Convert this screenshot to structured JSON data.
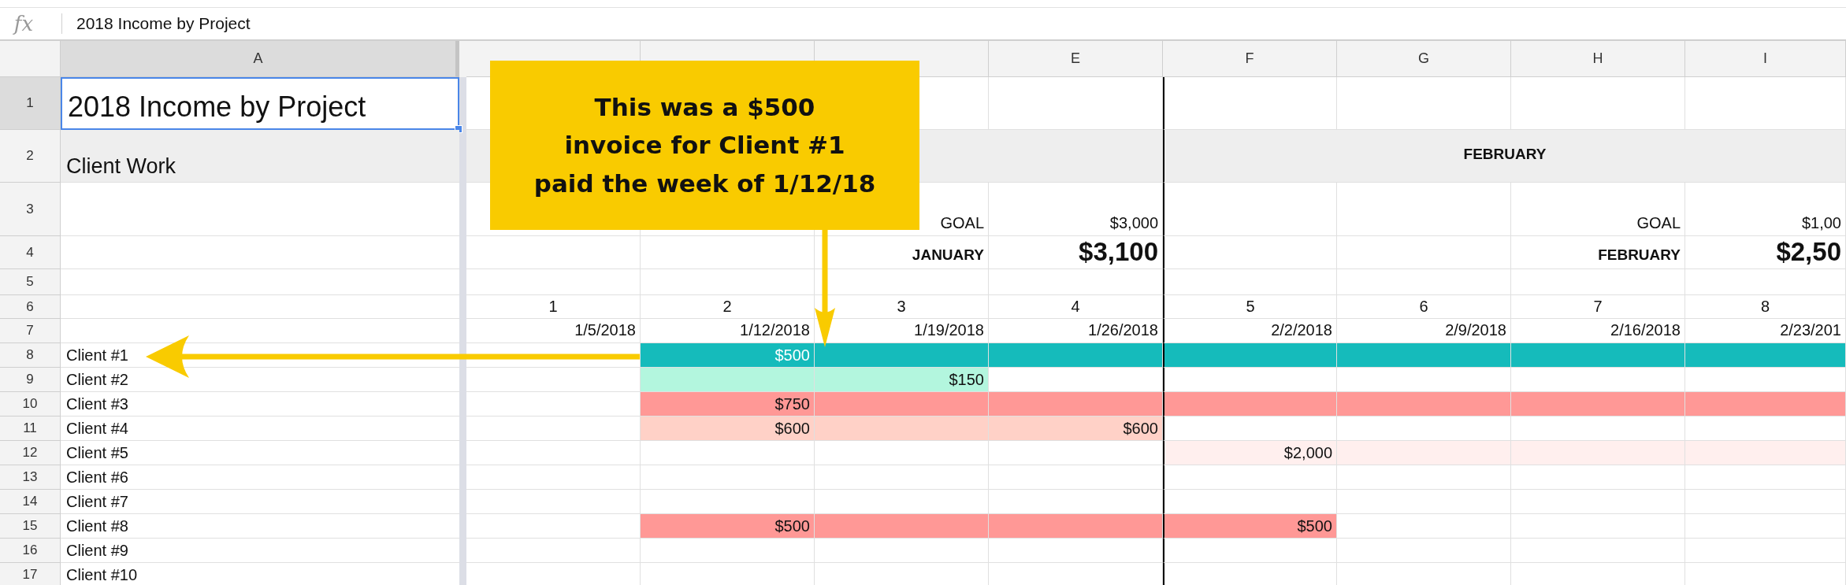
{
  "formula_bar": {
    "icon": "fx",
    "value": "2018 Income by Project"
  },
  "columns": [
    {
      "label": "A",
      "selected": true
    },
    {
      "selected": false
    },
    {
      "selected": false
    },
    {
      "selected": false
    },
    {
      "label": "E",
      "selected": false
    },
    {
      "label": "F",
      "selected": false,
      "divider": true
    },
    {
      "label": "G",
      "selected": false
    },
    {
      "label": "H",
      "selected": false
    },
    {
      "label": "I",
      "selected": false
    }
  ],
  "rows": [
    {
      "number": "1",
      "kind": "title",
      "selected": true,
      "a": {
        "text": "2018 Income by Project",
        "selected": true
      },
      "cells": [
        {},
        {},
        {},
        {},
        {},
        {},
        {},
        {}
      ]
    },
    {
      "number": "2",
      "kind": "month",
      "selected": false,
      "a": {
        "text": "Client Work",
        "selected": false
      },
      "cells": [
        {},
        {
          "text": "FEBRUARY"
        }
      ]
    },
    {
      "number": "3",
      "kind": "goal",
      "selected": false,
      "cells": [
        {},
        {},
        {
          "text": "GOAL"
        },
        {
          "text": "$3,000"
        },
        {},
        {},
        {
          "text": "GOAL"
        },
        {
          "text": "$1,00"
        }
      ]
    },
    {
      "number": "4",
      "kind": "total",
      "selected": false,
      "cells": [
        {},
        {},
        {
          "text": "JANUARY",
          "kind": "label"
        },
        {
          "text": "$3,100",
          "kind": "total"
        },
        {},
        {},
        {
          "text": "FEBRUARY",
          "kind": "label"
        },
        {
          "text": "$2,50",
          "kind": "total"
        }
      ]
    },
    {
      "number": "5",
      "kind": "blank",
      "selected": false,
      "cells": [
        {},
        {},
        {},
        {},
        {},
        {},
        {},
        {}
      ]
    },
    {
      "number": "6",
      "kind": "week",
      "selected": false,
      "cells": [
        {
          "text": "1"
        },
        {
          "text": "2"
        },
        {
          "text": "3"
        },
        {
          "text": "4"
        },
        {
          "text": "5"
        },
        {
          "text": "6"
        },
        {
          "text": "7"
        },
        {
          "text": "8"
        }
      ]
    },
    {
      "number": "7",
      "kind": "date",
      "selected": false,
      "cells": [
        {
          "text": "1/5/2018"
        },
        {
          "text": "1/12/2018"
        },
        {
          "text": "1/19/2018"
        },
        {
          "text": "1/26/2018"
        },
        {
          "text": "2/2/2018"
        },
        {
          "text": "2/9/2018"
        },
        {
          "text": "2/16/2018"
        },
        {
          "text": "2/23/201"
        }
      ]
    },
    {
      "number": "8",
      "kind": "client",
      "selected": false,
      "a": {
        "text": "Client #1",
        "selected": false
      },
      "cells": [
        {},
        {
          "text": "$500",
          "color": "#15bbbb"
        },
        {
          "color": "#15bbbb"
        },
        {
          "color": "#15bbbb"
        },
        {
          "color": "#15bbbb"
        },
        {
          "color": "#15bbbb"
        },
        {
          "color": "#15bbbb"
        },
        {
          "color": "#15bbbb"
        }
      ]
    },
    {
      "number": "9",
      "kind": "client",
      "selected": false,
      "a": {
        "text": "Client #2",
        "selected": false
      },
      "cells": [
        {},
        {
          "color": "#b3f6de"
        },
        {
          "text": "$150",
          "color": "#b3f6de"
        },
        {},
        {},
        {},
        {},
        {}
      ]
    },
    {
      "number": "10",
      "kind": "client",
      "selected": false,
      "a": {
        "text": "Client #3",
        "selected": false
      },
      "cells": [
        {},
        {
          "text": "$750",
          "color": "#ff9896"
        },
        {
          "color": "#ff9896"
        },
        {
          "color": "#ff9896"
        },
        {
          "color": "#ff9896"
        },
        {
          "color": "#ff9896"
        },
        {
          "color": "#ff9896"
        },
        {
          "color": "#ff9896"
        }
      ]
    },
    {
      "number": "11",
      "kind": "client",
      "selected": false,
      "a": {
        "text": "Client #4",
        "selected": false
      },
      "cells": [
        {},
        {
          "text": "$600",
          "color": "#ffd1c7"
        },
        {
          "color": "#ffd1c7"
        },
        {
          "text": "$600",
          "color": "#ffd1c7"
        },
        {},
        {},
        {},
        {}
      ]
    },
    {
      "number": "12",
      "kind": "client",
      "selected": false,
      "a": {
        "text": "Client #5",
        "selected": false
      },
      "cells": [
        {},
        {},
        {},
        {},
        {
          "text": "$2,000",
          "color": "#ffefee"
        },
        {
          "color": "#ffefee"
        },
        {
          "color": "#ffefee"
        },
        {
          "color": "#ffefee"
        }
      ]
    },
    {
      "number": "13",
      "kind": "client",
      "selected": false,
      "a": {
        "text": "Client #6",
        "selected": false
      },
      "cells": [
        {},
        {},
        {},
        {},
        {},
        {},
        {},
        {}
      ]
    },
    {
      "number": "14",
      "kind": "client",
      "selected": false,
      "a": {
        "text": "Client #7",
        "selected": false
      },
      "cells": [
        {},
        {},
        {},
        {},
        {},
        {},
        {},
        {}
      ]
    },
    {
      "number": "15",
      "kind": "client",
      "selected": false,
      "a": {
        "text": "Client #8",
        "selected": false
      },
      "cells": [
        {},
        {
          "text": "$500",
          "color": "#ff9896"
        },
        {
          "color": "#ff9896"
        },
        {
          "color": "#ff9896"
        },
        {
          "text": "$500",
          "color": "#ff9896"
        },
        {},
        {},
        {}
      ]
    },
    {
      "number": "16",
      "kind": "client",
      "selected": false,
      "a": {
        "text": "Client #9",
        "selected": false
      },
      "cells": [
        {},
        {},
        {},
        {},
        {},
        {},
        {},
        {}
      ]
    },
    {
      "number": "17",
      "kind": "client",
      "selected": false,
      "a": {
        "text": "Client #10",
        "selected": false
      },
      "cells": [
        {},
        {},
        {},
        {},
        {},
        {},
        {},
        {}
      ]
    }
  ],
  "callout": {
    "text": "This was a $500\ninvoice for Client #1\npaid the week of 1/12/18"
  }
}
